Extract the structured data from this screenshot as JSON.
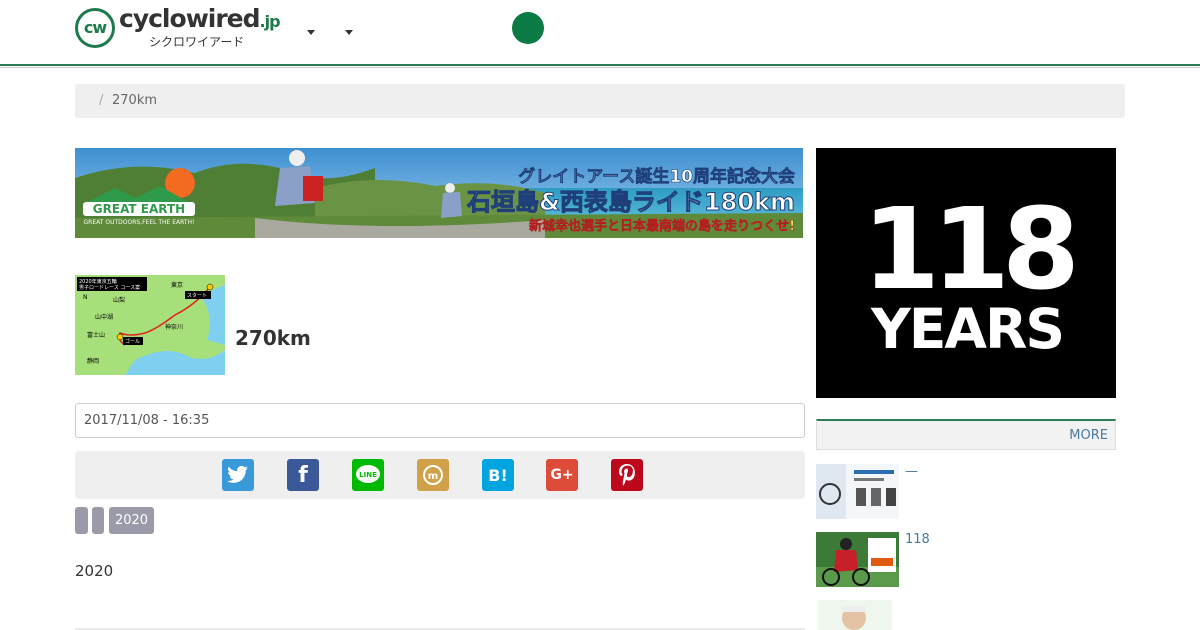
{
  "header": {
    "logo_mark": "cw",
    "logo_name_part1": "cyclo",
    "logo_name_part2": "wired",
    "logo_tld": ".jp",
    "logo_sub": "シクロワイアード",
    "accent_color": "#2f7d55"
  },
  "breadcrumb": {
    "separator": "/",
    "current": "270km"
  },
  "banner": {
    "headline": "グレイトアース誕生10周年記念大会",
    "title": "石垣島&西表島ライド180km",
    "subtitle": "新城幸也選手と日本最南端の島を走りつくせ!",
    "brand": "GREAT EARTH",
    "brand_tagline": "GREAT OUTDOORS,FEEL THE EARTH!"
  },
  "tag": {
    "title": "270km",
    "map_heading_1": "2020年東京五輪",
    "map_heading_2": "男子ロードレース コース案",
    "map_labels": [
      "東京",
      "スタート",
      "山梨",
      "山中湖",
      "神奈川",
      "富士山",
      "ゴール",
      "静岡",
      "N"
    ]
  },
  "meta": {
    "date": "2017/11/08 - 16:35"
  },
  "share": [
    {
      "name": "twitter",
      "color": "#3a9ad9",
      "glyph": "t"
    },
    {
      "name": "facebook",
      "color": "#3b5998",
      "glyph": "f"
    },
    {
      "name": "line",
      "color": "#00b900",
      "glyph": "LINE"
    },
    {
      "name": "mixi",
      "color": "#d1a14a",
      "glyph": "m"
    },
    {
      "name": "hatena",
      "color": "#00a4de",
      "glyph": "B!"
    },
    {
      "name": "google-plus",
      "color": "#dd4b39",
      "glyph": "G+"
    },
    {
      "name": "pinterest",
      "color": "#bd081c",
      "glyph": "P"
    }
  ],
  "tags": {
    "tag3": "2020"
  },
  "content": {
    "text": "2020"
  },
  "sidebar": {
    "ad_line1": "118",
    "ad_line2": "YEARS",
    "more": "MORE",
    "items": [
      {
        "link": "—"
      },
      {
        "link": "118"
      },
      {
        "link": ""
      }
    ]
  }
}
